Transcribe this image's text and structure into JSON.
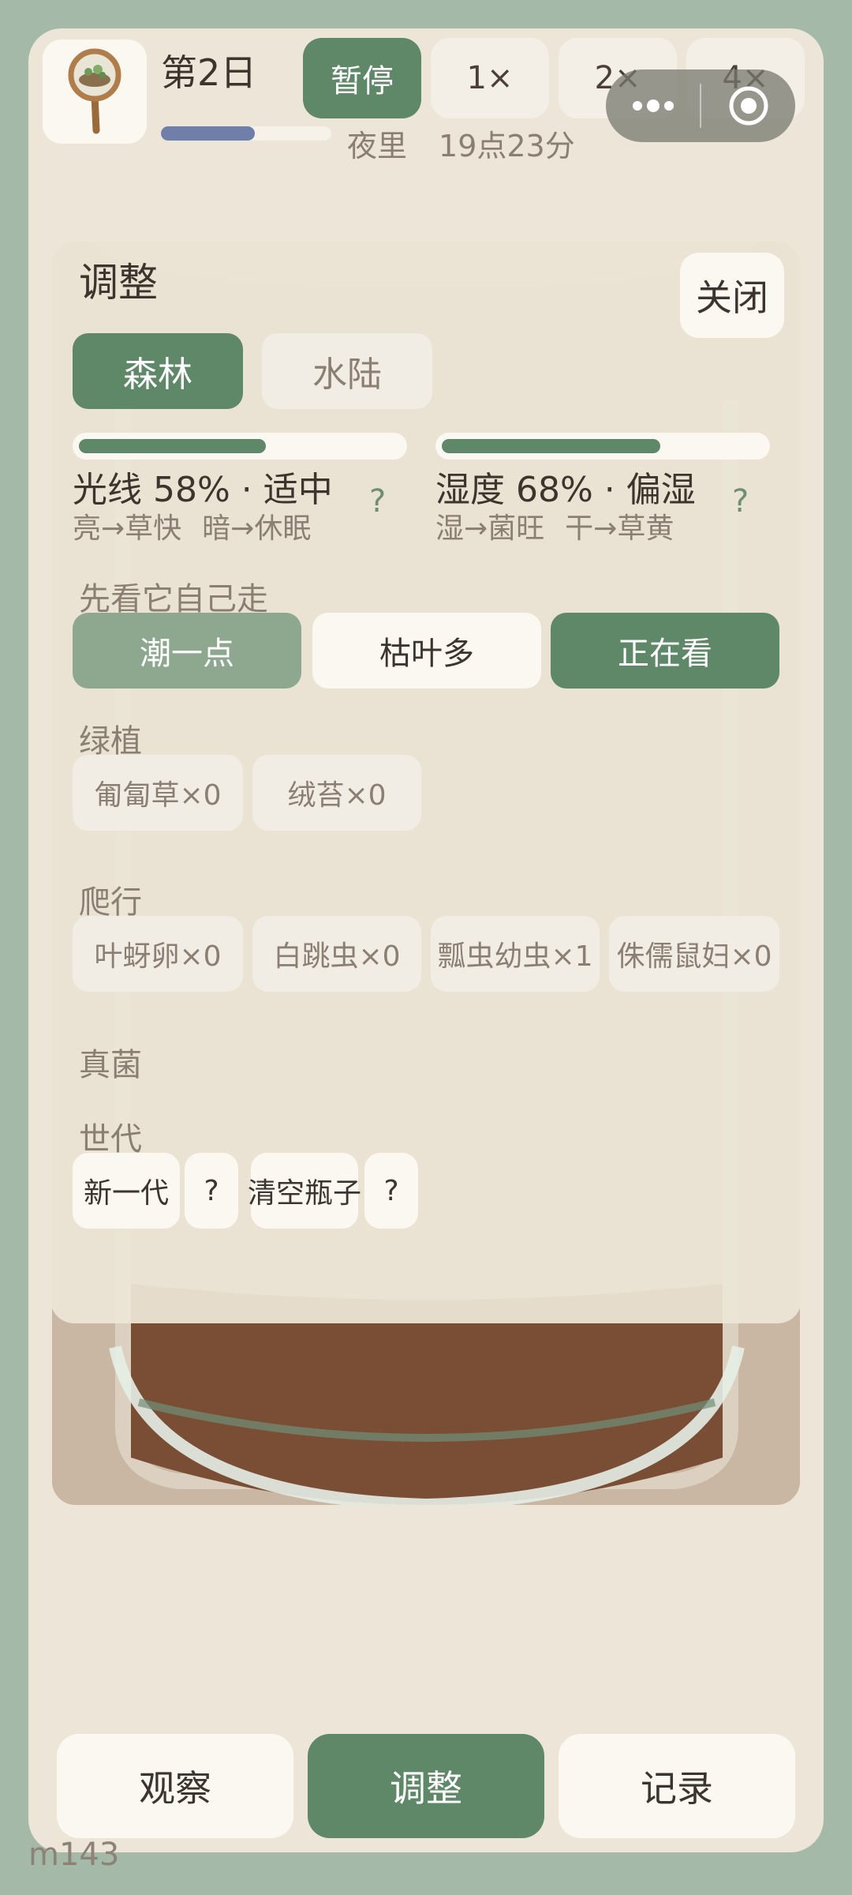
{
  "header": {
    "day_title": "第2日",
    "day_progress": 0.55,
    "period": "夜里",
    "clock": "19点23分",
    "speed_buttons": [
      {
        "label": "暂停",
        "active": true
      },
      {
        "label": "1×",
        "active": false
      },
      {
        "label": "2×",
        "active": false
      },
      {
        "label": "4×",
        "active": false
      }
    ]
  },
  "panel": {
    "title": "调整",
    "close_label": "关闭",
    "habitat_tabs": [
      {
        "label": "森林",
        "active": true
      },
      {
        "label": "水陆",
        "active": false
      }
    ],
    "meters": {
      "light": {
        "value": 0.58,
        "label": "光线 58% · 适中",
        "hint_a": "亮→草快",
        "hint_b": "暗→休眠",
        "help": "?"
      },
      "humidity": {
        "value": 0.68,
        "label": "湿度 68% · 偏湿",
        "hint_a": "湿→菌旺",
        "hint_b": "干→草黄",
        "help": "?"
      }
    },
    "watch_section": {
      "label": "先看它自己走",
      "actions": [
        "潮一点",
        "枯叶多",
        "正在看"
      ]
    },
    "plants": {
      "label": "绿植",
      "items": [
        "匍匐草×0",
        "绒苔×0"
      ]
    },
    "crawlers": {
      "label": "爬行",
      "items": [
        "叶蚜卵×0",
        "白跳虫×0",
        "瓢虫幼虫×1",
        "侏儒鼠妇×0"
      ]
    },
    "fungi": {
      "label": "真菌"
    },
    "generation": {
      "label": "世代",
      "new_gen": "新一代",
      "clear": "清空瓶子",
      "help": "?"
    }
  },
  "nav": {
    "items": [
      {
        "label": "观察",
        "active": false
      },
      {
        "label": "调整",
        "active": true
      },
      {
        "label": "记录",
        "active": false
      }
    ]
  },
  "build_tag": "m143",
  "colors": {
    "accent": "#5e8868",
    "accent_soft": "#8ea890",
    "progress": "#6f7faa",
    "background": "#a4b9a8",
    "app_bg": "#ece5d8"
  }
}
